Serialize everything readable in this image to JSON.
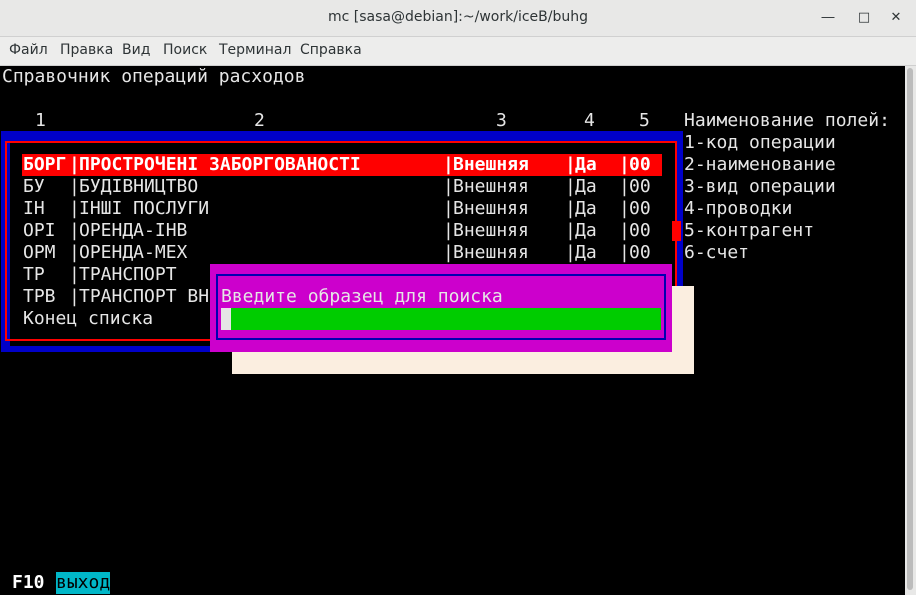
{
  "window": {
    "title": "mc [sasa@debian]:~/work/iceB/buhg"
  },
  "window_controls": {
    "minimize": "✕",
    "maximize": "□",
    "close": "✕"
  },
  "menu": {
    "file": "Файл",
    "edit": "Правка",
    "view": "Вид",
    "search": "Поиск",
    "terminal": "Терминал",
    "help": "Справка"
  },
  "screen": {
    "heading": "Справочник операций расходов",
    "column_numbers": [
      "1",
      "2",
      "3",
      "4",
      "5"
    ],
    "fields_title": "Наименование полей:",
    "fields": [
      "1-код операции",
      "2-наименование",
      "3-вид операции",
      "4-проводки",
      "5-контрагент",
      "6-счет"
    ]
  },
  "table": {
    "rows": [
      {
        "code": "БОРГ",
        "name": "ПРОСТРОЧЕНІ ЗАБОРГОВАНОСТІ",
        "kind": "Внешняя",
        "posting": "Да",
        "contr": "00"
      },
      {
        "code": "БУ  ",
        "name": "БУДІВНИЦТВО",
        "kind": "Внешняя",
        "posting": "Да",
        "contr": "00"
      },
      {
        "code": "ІН  ",
        "name": "ІНШІ ПОСЛУГИ",
        "kind": "Внешняя",
        "posting": "Да",
        "contr": "00"
      },
      {
        "code": "ОРІ ",
        "name": "ОРЕНДА-ІНВ",
        "kind": "Внешняя",
        "posting": "Да",
        "contr": "00"
      },
      {
        "code": "ОРМ ",
        "name": "ОРЕНДА-МЕХ",
        "kind": "Внешняя",
        "posting": "Да",
        "contr": "00"
      },
      {
        "code": "ТР  ",
        "name": "ТРАНСПОРТ",
        "kind": "",
        "posting": "",
        "contr": ""
      },
      {
        "code": "ТРВ ",
        "name": "ТРАНСПОРТ ВН",
        "kind": "",
        "posting": "",
        "contr": ""
      }
    ],
    "end_label": "Конец списка"
  },
  "search_dialog": {
    "prompt": "Введите образец для поиска",
    "value": ""
  },
  "footer": {
    "key": "F10",
    "label": "выход"
  },
  "colors": {
    "list_bg": "#0000c8",
    "selection": "#ff0000",
    "dialog": "#cc00cc",
    "input": "#00cc00",
    "shadow": "#fbeee0",
    "exit_bg": "#00b7c8"
  }
}
